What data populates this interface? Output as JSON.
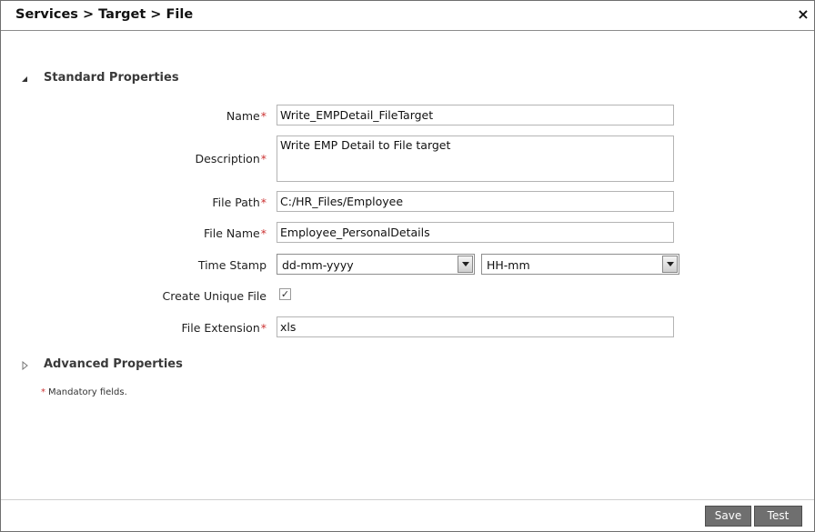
{
  "dialog": {
    "title": "Services > Target > File",
    "close_glyph": "×"
  },
  "standard_properties": {
    "label": "Standard Properties",
    "icon": "triangle-expanded-icon",
    "fields": {
      "name": {
        "label": "Name",
        "value": "Write_EMPDetail_FileTarget",
        "required": true
      },
      "description": {
        "label": "Description",
        "value": "Write EMP Detail to File target",
        "required": true
      },
      "file_path": {
        "label": "File Path",
        "value": "C:/HR_Files/Employee",
        "required": true
      },
      "file_name": {
        "label": "File Name",
        "value": "Employee_PersonalDetails",
        "required": true
      },
      "time_stamp": {
        "label": "Time Stamp",
        "date_format": "dd-mm-yyyy",
        "time_format": "HH-mm"
      },
      "create_unique_file": {
        "label": "Create Unique File",
        "checked": true,
        "check_glyph": "✓"
      },
      "file_extension": {
        "label": "File Extension",
        "value": "xls",
        "required": true
      }
    }
  },
  "advanced_properties": {
    "label": "Advanced Properties",
    "icon": "triangle-collapsed-icon"
  },
  "required_marker": "*",
  "mandatory_note": "Mandatory fields.",
  "footer": {
    "save_label": "Save",
    "test_label": "Test"
  },
  "colors": {
    "required": "#cc3333",
    "button_bg": "#6f6f6f",
    "border": "#b4b4b4"
  }
}
